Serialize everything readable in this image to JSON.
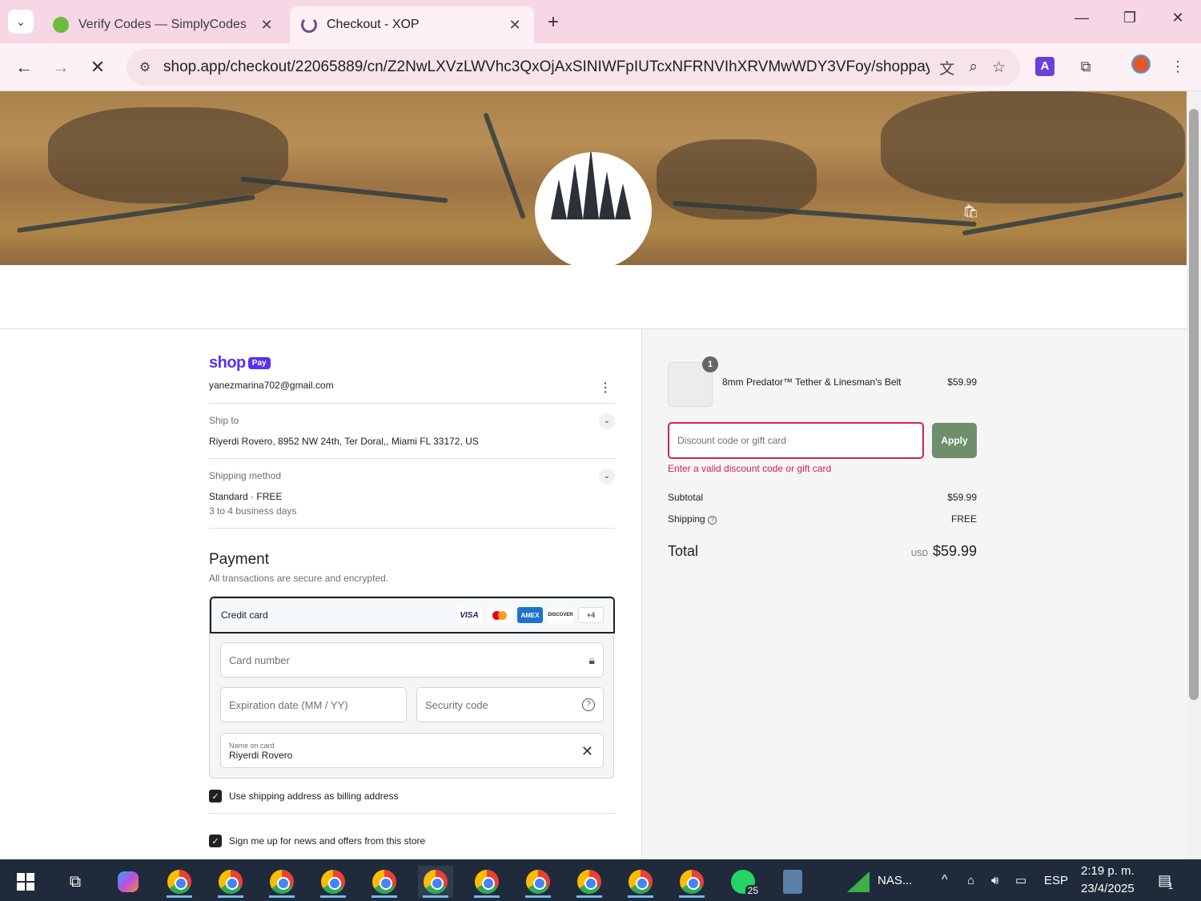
{
  "browser": {
    "tabs": [
      {
        "title": "Verify Codes — SimplyCodes",
        "active": false
      },
      {
        "title": "Checkout - XOP",
        "active": true
      }
    ],
    "url": "shop.app/checkout/22065889/cn/Z2NwLXVzLWVhc3QxOjAxSINIWFpIUTcxNFRNVIhXRVMwWDY3VFoy/shoppay?..."
  },
  "checkout": {
    "email": "yanezmarina702@gmail.com",
    "ship_to_label": "Ship to",
    "ship_to_value": "Riyerdi Rovero, 8952 NW 24th, Ter Doral,, Miami FL 33172, US",
    "shipping_method_label": "Shipping method",
    "shipping_method_value": "Standard · FREE",
    "shipping_method_eta": "3 to 4 business days",
    "payment_title": "Payment",
    "payment_subtitle": "All transactions are secure and encrypted.",
    "credit_card_label": "Credit card",
    "card_brands": [
      "VISA",
      "MC",
      "AMEX",
      "DISCOVER",
      "+4"
    ],
    "card_number_placeholder": "Card number",
    "expiration_placeholder": "Expiration date (MM / YY)",
    "security_placeholder": "Security code",
    "name_on_card_label": "Name on card",
    "name_on_card_value": "Riyerdi Rovero",
    "billing_checkbox_label": "Use shipping address as billing address",
    "news_checkbox_label": "Sign me up for news and offers from this store"
  },
  "order": {
    "item_qty": "1",
    "item_name": "8mm Predator™ Tether & Linesman's Belt",
    "item_price": "$59.99",
    "discount_placeholder": "Discount code or gift card",
    "apply_label": "Apply",
    "discount_error": "Enter a valid discount code or gift card",
    "subtotal_label": "Subtotal",
    "subtotal_value": "$59.99",
    "shipping_label": "Shipping",
    "shipping_value": "FREE",
    "total_label": "Total",
    "total_currency": "USD",
    "total_value": "$59.99"
  },
  "taskbar": {
    "nas_label": "NAS...",
    "lang": "ESP",
    "time": "2:19 p. m.",
    "date": "23/4/2025",
    "whatsapp_badge": "25",
    "notif_badge": "1"
  }
}
